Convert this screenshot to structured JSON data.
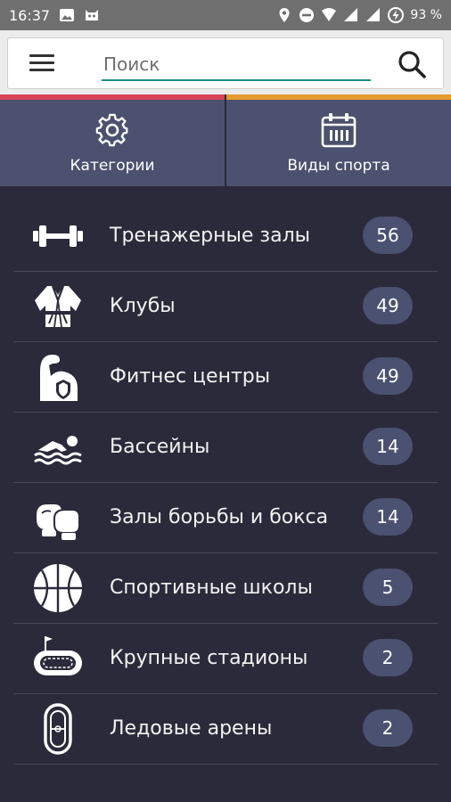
{
  "status_bar": {
    "time": "16:37",
    "battery": "93 %"
  },
  "search": {
    "placeholder": "Поиск"
  },
  "tabs": [
    {
      "label": "Категории",
      "icon": "gear-icon",
      "accent": "#d8435a"
    },
    {
      "label": "Виды спорта",
      "icon": "calendar-icon",
      "accent": "#e49a2e"
    }
  ],
  "categories": [
    {
      "label": "Тренажерные залы",
      "count": "56",
      "icon": "dumbbell-icon"
    },
    {
      "label": "Клубы",
      "count": "49",
      "icon": "kimono-icon"
    },
    {
      "label": "Фитнес центры",
      "count": "49",
      "icon": "biceps-icon"
    },
    {
      "label": "Бассейны",
      "count": "14",
      "icon": "swimmer-icon"
    },
    {
      "label": "Залы борьбы и бокса",
      "count": "14",
      "icon": "boxing-gloves-icon"
    },
    {
      "label": "Спортивные школы",
      "count": "5",
      "icon": "basketball-icon"
    },
    {
      "label": "Крупные стадионы",
      "count": "2",
      "icon": "stadium-icon"
    },
    {
      "label": "Ледовые арены",
      "count": "2",
      "icon": "ice-rink-icon"
    }
  ],
  "colors": {
    "background": "#2b2a3a",
    "tab_background": "#4b516e",
    "badge": "#4b5170",
    "search_underline": "#1a8f84"
  }
}
